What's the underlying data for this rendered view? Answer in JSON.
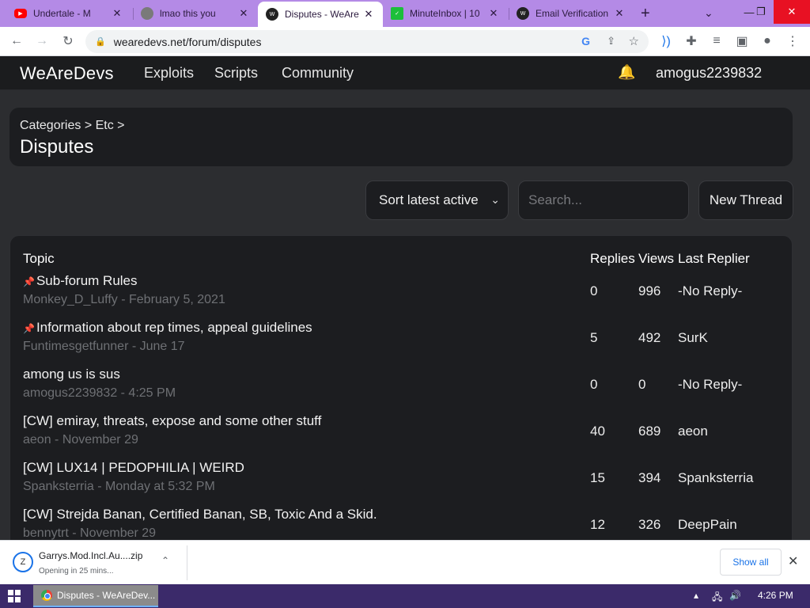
{
  "browser": {
    "tabs": [
      {
        "title": "Undertale - M",
        "favicon": "youtube-icon",
        "color": "#ff0000"
      },
      {
        "title": "lmao this you",
        "favicon": "globe-icon",
        "color": "#7a7a7a"
      },
      {
        "title": "Disputes - WeAre",
        "favicon": "wad-icon",
        "color": "#222222",
        "active": true
      },
      {
        "title": "MinuteInbox | 10",
        "favicon": "check-icon",
        "color": "#1cbf3a"
      },
      {
        "title": "Email Verification",
        "favicon": "wad-icon",
        "color": "#222222"
      }
    ],
    "url": "wearedevs.net/forum/disputes"
  },
  "site": {
    "brand": "WeAreDevs",
    "nav": [
      "Exploits",
      "Scripts",
      "Community"
    ],
    "user": "amogus2239832"
  },
  "breadcrumb": {
    "path": "Categories > Etc >",
    "title": "Disputes"
  },
  "controls": {
    "sort_label": "Sort latest active",
    "search_placeholder": "Search...",
    "new_thread_label": "New Thread"
  },
  "table": {
    "headers": {
      "topic": "Topic",
      "replies": "Replies",
      "views": "Views",
      "last_replier": "Last Replier"
    },
    "rows": [
      {
        "pinned": true,
        "title": "Sub-forum Rules",
        "meta": "Monkey_D_Luffy - February 5, 2021",
        "replies": "0",
        "views": "996",
        "last": "-No Reply-"
      },
      {
        "pinned": true,
        "title": "Information about rep times, appeal guidelines",
        "meta": "Funtimesgetfunner - June 17",
        "replies": "5",
        "views": "492",
        "last": "SurK"
      },
      {
        "pinned": false,
        "title": "among us is sus",
        "meta": "amogus2239832 - 4:25 PM",
        "replies": "0",
        "views": "0",
        "last": "-No Reply-"
      },
      {
        "pinned": false,
        "title": "[CW] emiray, threats, expose and some other stuff",
        "meta": "aeon - November 29",
        "replies": "40",
        "views": "689",
        "last": "aeon"
      },
      {
        "pinned": false,
        "title": "[CW] LUX14 | PEDOPHILIA | WEIRD",
        "meta": "Spanksterria - Monday at 5:32 PM",
        "replies": "15",
        "views": "394",
        "last": "Spanksterria"
      },
      {
        "pinned": false,
        "title": "[CW] Strejda Banan, Certified Banan, SB, Toxic And a Skid.",
        "meta": "bennytrt - November 29",
        "replies": "12",
        "views": "326",
        "last": "DeepPain"
      }
    ]
  },
  "download": {
    "file": "Garrys.Mod.Incl.Au....zip",
    "status": "Opening in 25 mins...",
    "show_all": "Show all"
  },
  "taskbar": {
    "task_label": "Disputes - WeAreDev...",
    "clock": "4:26 PM"
  }
}
